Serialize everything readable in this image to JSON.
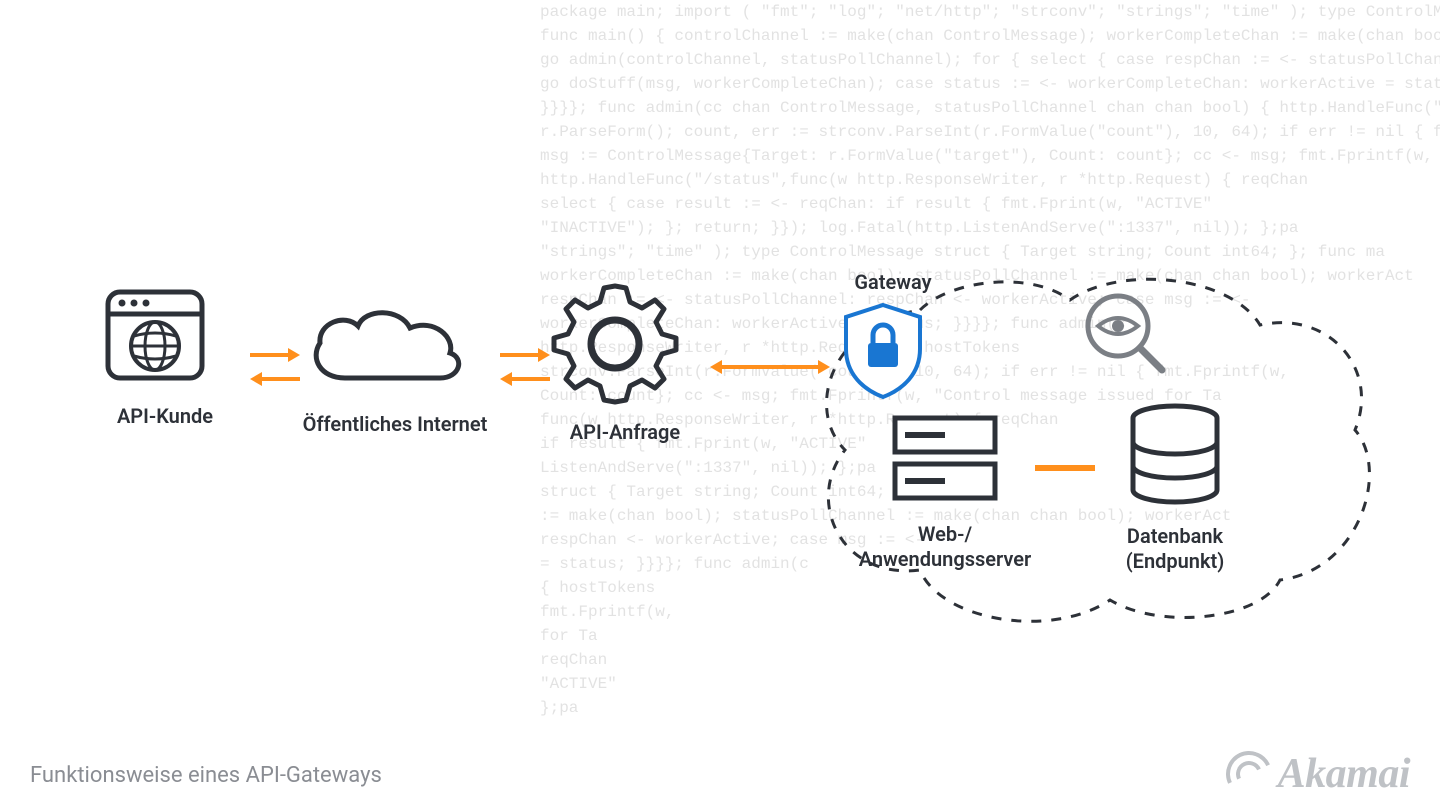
{
  "caption": "Funktionsweise eines API-Gateways",
  "logo": "Akamai",
  "labels": {
    "api_kunde": "API-Kunde",
    "internet": "Öffentliches Internet",
    "api_anfrage": "API-Anfrage",
    "gateway": "Gateway",
    "web_app": "Web-/\nAnwendungsserver",
    "db": "Datenbank\n(Endpunkt)"
  },
  "bg_code": "package main; import ( \"fmt\"; \"log\"; \"net/http\"; \"strconv\"; \"strings\"; \"time\" ); type ControlMessage struct { Target string; Cou\nfunc main() { controlChannel := make(chan ControlMessage); workerCompleteChan := make(chan bool); statusPollChannel := make(chan chan bool); w\ngo admin(controlChannel, statusPollChannel); for { select { case respChan := <- statusPollChannel: respChan <- workerActive; case\ngo doStuff(msg, workerCompleteChan); case status := <- workerCompleteChan: workerActive = status;\n}}}}; func admin(cc chan ControlMessage, statusPollChannel chan chan bool) { http.HandleFunc(\"/admin\", func(w http.ResponseWriter, r *http.Request) { hostTok\nr.ParseForm(); count, err := strconv.ParseInt(r.FormValue(\"count\"), 10, 64); if err != nil { fmt.Fprintf(w,\nmsg := ControlMessage{Target: r.FormValue(\"target\"), Count: count}; cc <- msg; fmt.Fprintf(w, \"Control message issued for Ta\nhttp.HandleFunc(\"/status\",func(w http.ResponseWriter, r *http.Request) { reqChan\nselect { case result := <- reqChan: if result { fmt.Fprint(w, \"ACTIVE\"\n\"INACTIVE\"); }; return; }}); log.Fatal(http.ListenAndServe(\":1337\", nil)); };pa\n\"strings\"; \"time\" ); type ControlMessage struct { Target string; Count int64; }; func ma\nworkerCompleteChan := make(chan bool); statusPollChannel := make(chan chan bool); workerAct\nrespChan := <- statusPollChannel: respChan <- workerActive; case msg := <-\nworkerCompleteChan: workerActive = status; }}}}; func admin(c\nhttp.ResponseWriter, r *http.Request) { hostTokens\nstrconv.ParseInt(r.FormValue(\"count\"), 10, 64); if err != nil { fmt.Fprintf(w,\nCount: count}; cc <- msg; fmt.Fprintf(w, \"Control message issued for Ta\nfunc(w http.ResponseWriter, r *http.Request) { reqChan\nif result { fmt.Fprint(w, \"ACTIVE\"\nListenAndServe(\":1337\", nil)); };pa\nstruct { Target string; Count int64; }; func ma\n:= make(chan bool); statusPollChannel := make(chan chan bool); workerAct\nrespChan <- workerActive; case msg := <-\n= status; }}}}; func admin(c\n{ hostTokens\nfmt.Fprintf(w,\nfor Ta\nreqChan\n\"ACTIVE\"\n};pa"
}
